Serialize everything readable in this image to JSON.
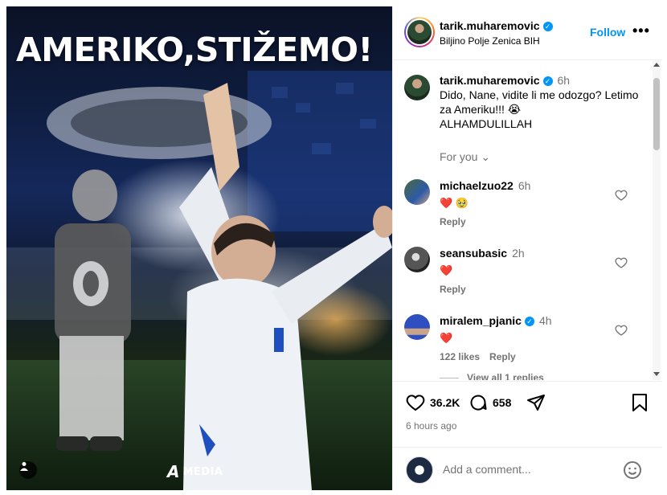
{
  "post": {
    "headline": "AMERIKO,STIŽEMO!",
    "watermark_mark": "A",
    "watermark_text": "MEDIA",
    "tagged_icon": "user-tag-icon"
  },
  "header": {
    "username": "tarik.muharemovic",
    "location": "Biljino Polje Zenica BIH",
    "follow_label": "Follow",
    "more_label": "•••"
  },
  "caption": {
    "username": "tarik.muharemovic",
    "time": "6h",
    "line1": "Dido, Nane, vidite li me odozgo? Letimo",
    "line2": "za Ameriku!!! 😭",
    "line3": "ALHAMDULILLAH"
  },
  "for_you": "For you ⌄",
  "comments": [
    {
      "username": "michaelzuo22",
      "time": "6h",
      "emoji": "❤️ 🥹",
      "likes": "",
      "reply": "Reply"
    },
    {
      "username": "seansubasic",
      "time": "2h",
      "emoji": "❤️",
      "likes": "",
      "reply": "Reply"
    },
    {
      "username": "miralem_pjanic",
      "time": "4h",
      "emoji": "❤️",
      "likes": "122 likes",
      "reply": "Reply",
      "view_replies": "View all 1 replies"
    }
  ],
  "actions": {
    "like_count": "36.2K",
    "comment_count": "658",
    "posted": "6 hours ago"
  },
  "add_comment": {
    "placeholder": "Add a comment..."
  },
  "colors": {
    "accent": "#0095f6",
    "muted": "#737373",
    "heart": "#ed4956"
  }
}
